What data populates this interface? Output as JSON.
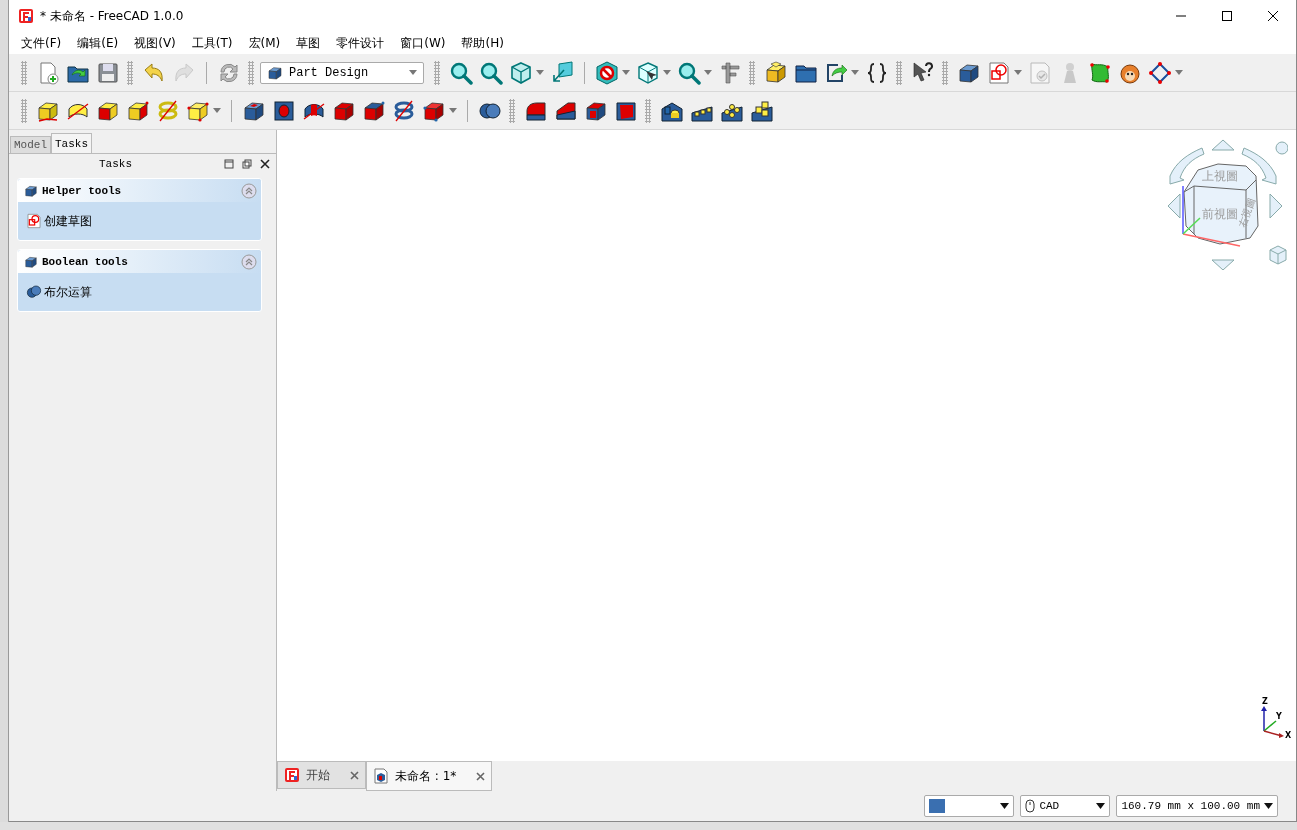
{
  "window": {
    "title": "* 未命名 - FreeCAD 1.0.0"
  },
  "menu": [
    "文件(F)",
    "编辑(E)",
    "视图(V)",
    "工具(T)",
    "宏(M)",
    "草图",
    "零件设计",
    "窗口(W)",
    "帮助(H)"
  ],
  "toolbars": [
    {
      "items": [
        {
          "kind": "handle"
        },
        {
          "kind": "tool",
          "dropdown": false,
          "disabled": false
        },
        {
          "kind": "tool",
          "dropdown": false,
          "disabled": false
        },
        {
          "kind": "tool",
          "dropdown": false,
          "disabled": false
        },
        {
          "kind": "handle"
        },
        {
          "kind": "tool",
          "dropdown": false,
          "disabled": false
        },
        {
          "kind": "tool",
          "dropdown": false,
          "disabled": true
        },
        {
          "kind": "separator"
        },
        {
          "kind": "tool",
          "dropdown": false,
          "disabled": false
        },
        {
          "kind": "handle"
        },
        {
          "kind": "combo",
          "value": "Part Design"
        },
        {
          "kind": "handle"
        },
        {
          "kind": "tool",
          "dropdown": false,
          "disabled": false
        },
        {
          "kind": "tool",
          "dropdown": false,
          "disabled": false
        },
        {
          "kind": "tool",
          "dropdown": true,
          "disabled": false
        },
        {
          "kind": "tool",
          "dropdown": false,
          "disabled": false
        },
        {
          "kind": "separator"
        },
        {
          "kind": "tool",
          "dropdown": true,
          "disabled": false
        },
        {
          "kind": "tool",
          "dropdown": true,
          "disabled": false
        },
        {
          "kind": "tool",
          "dropdown": true,
          "disabled": false
        },
        {
          "kind": "tool",
          "dropdown": false,
          "disabled": false
        },
        {
          "kind": "handle"
        },
        {
          "kind": "tool",
          "dropdown": false,
          "disabled": false
        },
        {
          "kind": "tool",
          "dropdown": false,
          "disabled": false
        },
        {
          "kind": "tool",
          "dropdown": true,
          "disabled": false
        },
        {
          "kind": "tool",
          "dropdown": false,
          "disabled": false
        },
        {
          "kind": "handle"
        },
        {
          "kind": "tool",
          "dropdown": false,
          "disabled": false
        },
        {
          "kind": "handle"
        },
        {
          "kind": "tool",
          "dropdown": false,
          "disabled": false
        },
        {
          "kind": "tool",
          "dropdown": true,
          "disabled": false
        },
        {
          "kind": "tool",
          "dropdown": false,
          "disabled": true
        },
        {
          "kind": "tool",
          "dropdown": false,
          "disabled": true
        },
        {
          "kind": "tool",
          "dropdown": false,
          "disabled": false
        },
        {
          "kind": "tool",
          "dropdown": false,
          "disabled": false
        },
        {
          "kind": "tool",
          "dropdown": true,
          "disabled": false
        }
      ]
    },
    {
      "items": [
        {
          "kind": "handle"
        },
        {
          "kind": "tool",
          "dropdown": false,
          "disabled": false
        },
        {
          "kind": "tool",
          "dropdown": false,
          "disabled": false
        },
        {
          "kind": "tool",
          "dropdown": false,
          "disabled": false
        },
        {
          "kind": "tool",
          "dropdown": false,
          "disabled": false
        },
        {
          "kind": "tool",
          "dropdown": false,
          "disabled": false
        },
        {
          "kind": "tool",
          "dropdown": true,
          "disabled": false
        },
        {
          "kind": "separator"
        },
        {
          "kind": "tool",
          "dropdown": false,
          "disabled": false
        },
        {
          "kind": "tool",
          "dropdown": false,
          "disabled": false
        },
        {
          "kind": "tool",
          "dropdown": false,
          "disabled": false
        },
        {
          "kind": "tool",
          "dropdown": false,
          "disabled": false
        },
        {
          "kind": "tool",
          "dropdown": false,
          "disabled": false
        },
        {
          "kind": "tool",
          "dropdown": false,
          "disabled": false
        },
        {
          "kind": "tool",
          "dropdown": true,
          "disabled": false
        },
        {
          "kind": "separator"
        },
        {
          "kind": "tool",
          "dropdown": false,
          "disabled": false
        },
        {
          "kind": "handle"
        },
        {
          "kind": "tool",
          "dropdown": false,
          "disabled": false
        },
        {
          "kind": "tool",
          "dropdown": false,
          "disabled": false
        },
        {
          "kind": "tool",
          "dropdown": false,
          "disabled": false
        },
        {
          "kind": "tool",
          "dropdown": false,
          "disabled": false
        },
        {
          "kind": "handle"
        },
        {
          "kind": "tool",
          "dropdown": false,
          "disabled": false
        },
        {
          "kind": "tool",
          "dropdown": false,
          "disabled": false
        },
        {
          "kind": "tool",
          "dropdown": false,
          "disabled": false
        },
        {
          "kind": "tool",
          "dropdown": false,
          "disabled": false
        }
      ]
    }
  ],
  "panel": {
    "tabs": [
      {
        "label": "Model",
        "selected": false
      },
      {
        "label": "Tasks",
        "selected": true
      }
    ],
    "title": "Tasks",
    "task_boxes": [
      {
        "title": "Helper tools",
        "items": [
          "创建草图"
        ]
      },
      {
        "title": "Boolean tools",
        "items": [
          "布尔运算"
        ]
      }
    ]
  },
  "view": {
    "nav_cube": {
      "top": "上視圖",
      "front": "前視圖",
      "right": "右視圖"
    },
    "axes": {
      "z": "Z",
      "y": "Y",
      "x": "X"
    }
  },
  "doc_tabs": [
    {
      "label": "开始",
      "selected": false
    },
    {
      "label": "未命名 : 1*",
      "selected": true
    }
  ],
  "status_bar": {
    "navigation": "CAD",
    "dimensions": "160.79 mm x 100.00 mm"
  }
}
